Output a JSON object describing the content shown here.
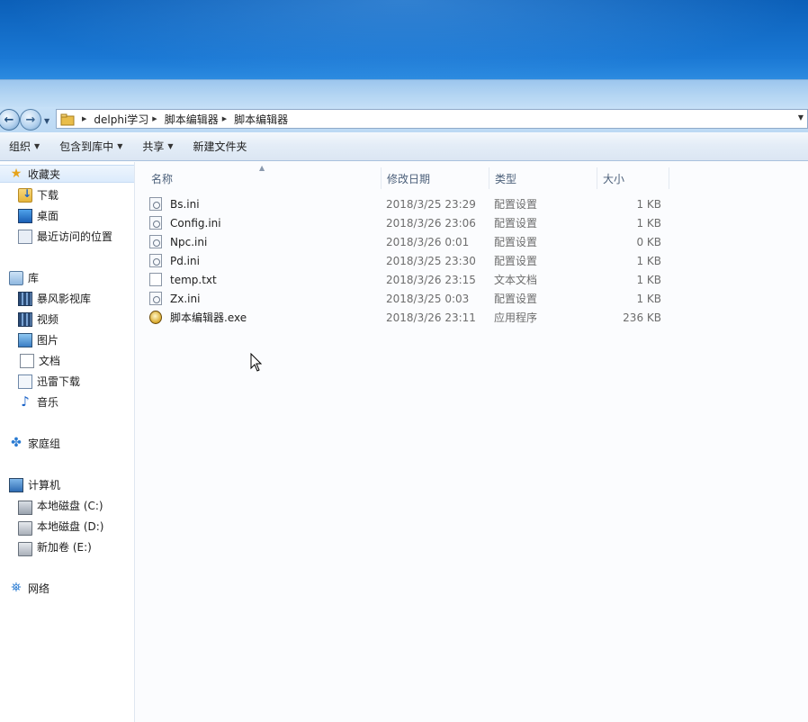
{
  "address_bar": {
    "crumbs": [
      "delphi学习",
      "脚本编辑器",
      "脚本编辑器"
    ]
  },
  "toolbar": {
    "organize": "组织",
    "include_in_library": "包含到库中",
    "share": "共享",
    "new_folder": "新建文件夹"
  },
  "sidebar": {
    "favorites": {
      "label": "收藏夹",
      "items": [
        "下载",
        "桌面",
        "最近访问的位置"
      ]
    },
    "libraries": {
      "label": "库",
      "items": [
        "暴风影视库",
        "视频",
        "图片",
        "文档",
        "迅雷下载",
        "音乐"
      ]
    },
    "homegroup": "家庭组",
    "computer": {
      "label": "计算机",
      "items": [
        "本地磁盘 (C:)",
        "本地磁盘 (D:)",
        "新加卷 (E:)"
      ]
    },
    "network": "网络"
  },
  "columns": {
    "name": "名称",
    "modified": "修改日期",
    "type": "类型",
    "size": "大小"
  },
  "files": [
    {
      "name": "Bs.ini",
      "modified": "2018/3/25 23:29",
      "type": "配置设置",
      "size": "1 KB",
      "icon": "ini-file-icon"
    },
    {
      "name": "Config.ini",
      "modified": "2018/3/26 23:06",
      "type": "配置设置",
      "size": "1 KB",
      "icon": "ini-file-icon"
    },
    {
      "name": "Npc.ini",
      "modified": "2018/3/26 0:01",
      "type": "配置设置",
      "size": "0 KB",
      "icon": "ini-file-icon"
    },
    {
      "name": "Pd.ini",
      "modified": "2018/3/25 23:30",
      "type": "配置设置",
      "size": "1 KB",
      "icon": "ini-file-icon"
    },
    {
      "name": "temp.txt",
      "modified": "2018/3/26 23:15",
      "type": "文本文档",
      "size": "1 KB",
      "icon": "text-file-icon"
    },
    {
      "name": "Zx.ini",
      "modified": "2018/3/25 0:03",
      "type": "配置设置",
      "size": "1 KB",
      "icon": "ini-file-icon"
    },
    {
      "name": "脚本编辑器.exe",
      "modified": "2018/3/26 23:11",
      "type": "应用程序",
      "size": "236 KB",
      "icon": "exe-app-icon"
    }
  ],
  "colors": {
    "desktop_blue": "#1a78d4",
    "window_bg": "#fbfcfe",
    "toolbar_bg": "#e4edf7",
    "header_text": "#4c607a"
  }
}
